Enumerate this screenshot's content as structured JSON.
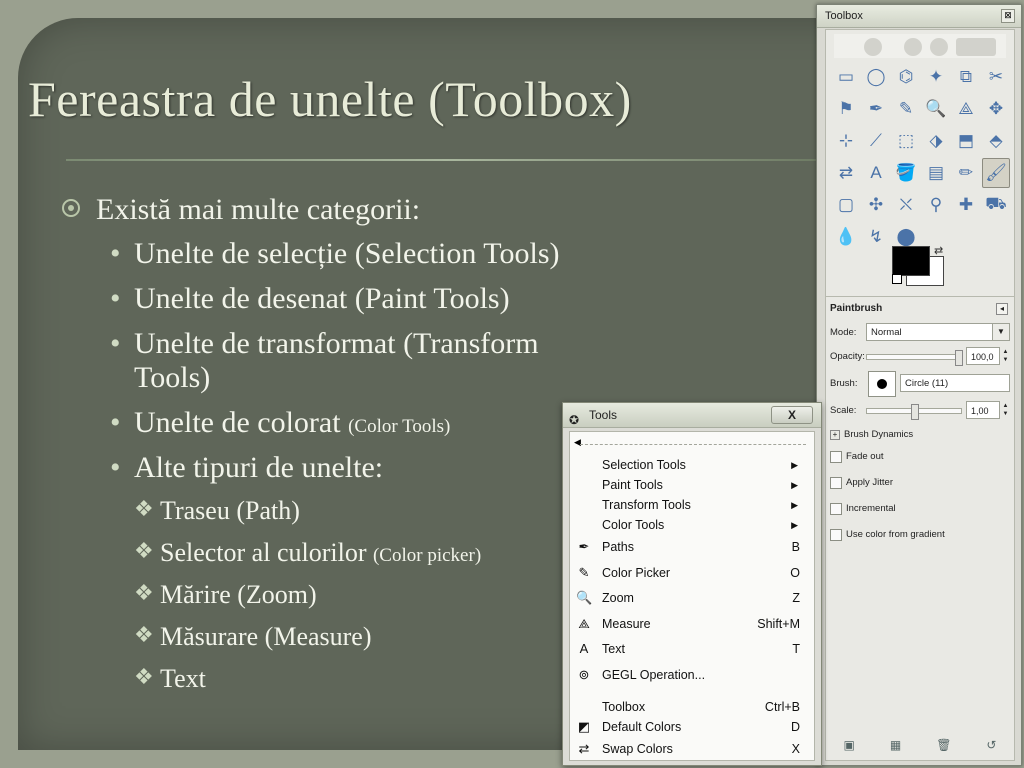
{
  "slide": {
    "title": "Fereastra de unelte (Toolbox)",
    "bullet_main": "Există mai multe categorii:",
    "bullets": [
      {
        "text": "Unelte de selecție (Selection Tools)",
        "small": ""
      },
      {
        "text": "Unelte de desenat (Paint Tools)",
        "small": ""
      },
      {
        "text": "Unelte de transformat (Transform Tools)",
        "small": ""
      },
      {
        "text": "Unelte de colorat ",
        "small": "(Color Tools)"
      },
      {
        "text": "Alte tipuri de unelte:",
        "small": ""
      }
    ],
    "subbullets": [
      {
        "text": "Traseu (Path)",
        "small": ""
      },
      {
        "text": "Selector al culorilor ",
        "small": "(Color picker)"
      },
      {
        "text": "Mărire (Zoom)",
        "small": ""
      },
      {
        "text": "Măsurare (Measure)",
        "small": ""
      },
      {
        "text": "Text",
        "small": ""
      }
    ],
    "sub_marker": "❖",
    "bullet_marker": "•"
  },
  "toolbox": {
    "title": "Toolbox",
    "close": "⊠",
    "tools": [
      "▭",
      "◯",
      "⌬",
      "✦",
      "⧉",
      "✂",
      "⚑",
      "✒",
      "✎",
      "🔍",
      "⟁",
      "✥",
      "⊹",
      "⟋",
      "⬚",
      "⬗",
      "⬒",
      "⬘",
      "⇄",
      "A",
      "🪣",
      "▤",
      "✏",
      "🖌",
      "▢",
      "✣",
      "⛌",
      "⚲",
      "✚",
      "⛟",
      "💧",
      "↯",
      "⬤"
    ],
    "active_tool": 23,
    "swap_icon": "⇄",
    "options": {
      "title": "Paintbrush",
      "mode_label": "Mode:",
      "mode_value": "Normal",
      "opacity_label": "Opacity:",
      "opacity_value": "100,0",
      "opacity_fraction": 1.0,
      "brush_label": "Brush:",
      "brush_value": "Circle (11)",
      "scale_label": "Scale:",
      "scale_value": "1,00",
      "scale_fraction": 0.5,
      "dynamics_label": "Brush Dynamics",
      "checks": [
        "Fade out",
        "Apply Jitter",
        "Incremental",
        "Use color from gradient"
      ]
    },
    "footer_icons": [
      "save-icon",
      "restore-icon",
      "delete-icon",
      "reset-icon"
    ]
  },
  "tools_menu": {
    "title": "Tools",
    "close": "X",
    "items": [
      {
        "icon": "",
        "label": "Selection Tools",
        "shortcut": "",
        "submenu": true
      },
      {
        "icon": "",
        "label": "Paint Tools",
        "shortcut": "",
        "submenu": true
      },
      {
        "icon": "",
        "label": "Transform Tools",
        "shortcut": "",
        "submenu": true
      },
      {
        "icon": "",
        "label": "Color Tools",
        "shortcut": "",
        "submenu": true
      },
      {
        "icon": "✒",
        "label": "Paths",
        "shortcut": "B",
        "submenu": false
      },
      {
        "icon": "✎",
        "label": "Color Picker",
        "shortcut": "O",
        "submenu": false
      },
      {
        "icon": "🔍",
        "label": "Zoom",
        "shortcut": "Z",
        "submenu": false
      },
      {
        "icon": "⟁",
        "label": "Measure",
        "shortcut": "Shift+M",
        "submenu": false
      },
      {
        "icon": "A",
        "label": "Text",
        "shortcut": "T",
        "submenu": false
      },
      {
        "icon": "⊚",
        "label": "GEGL Operation...",
        "shortcut": "",
        "submenu": false
      },
      {
        "icon": "",
        "label": "Toolbox",
        "shortcut": "Ctrl+B",
        "submenu": false
      },
      {
        "icon": "◩",
        "label": "Default Colors",
        "shortcut": "D",
        "submenu": false
      },
      {
        "icon": "⇄",
        "label": "Swap Colors",
        "shortcut": "X",
        "submenu": false
      }
    ]
  }
}
